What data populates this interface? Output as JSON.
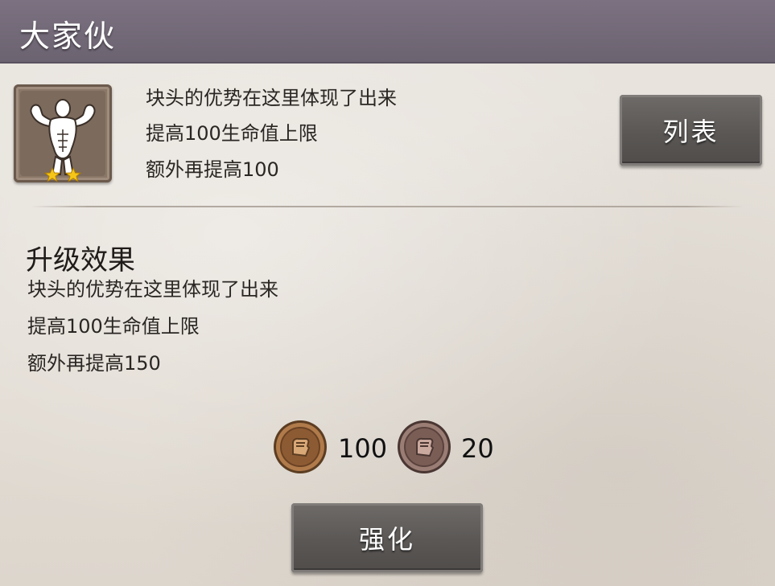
{
  "title": "大家伙",
  "skill": {
    "icon": "strongman-flex-icon",
    "stars": 2,
    "current_effect": [
      "块头的优势在这里体现了出来",
      "提高100生命值上限",
      "额外再提高100"
    ]
  },
  "list_button_label": "列表",
  "upgrade": {
    "heading": "升级效果",
    "effect": [
      "块头的优势在这里体现了出来",
      "提高100生命值上限",
      "额外再提高150"
    ]
  },
  "costs": [
    {
      "icon": "bronze-fist-coin-icon",
      "amount": "100"
    },
    {
      "icon": "silver-fist-coin-icon",
      "amount": "20"
    }
  ],
  "enhance_button_label": "强化",
  "colors": {
    "title_bar": "#6c6371",
    "button": "#5a5755",
    "background": "#e6e1da"
  }
}
